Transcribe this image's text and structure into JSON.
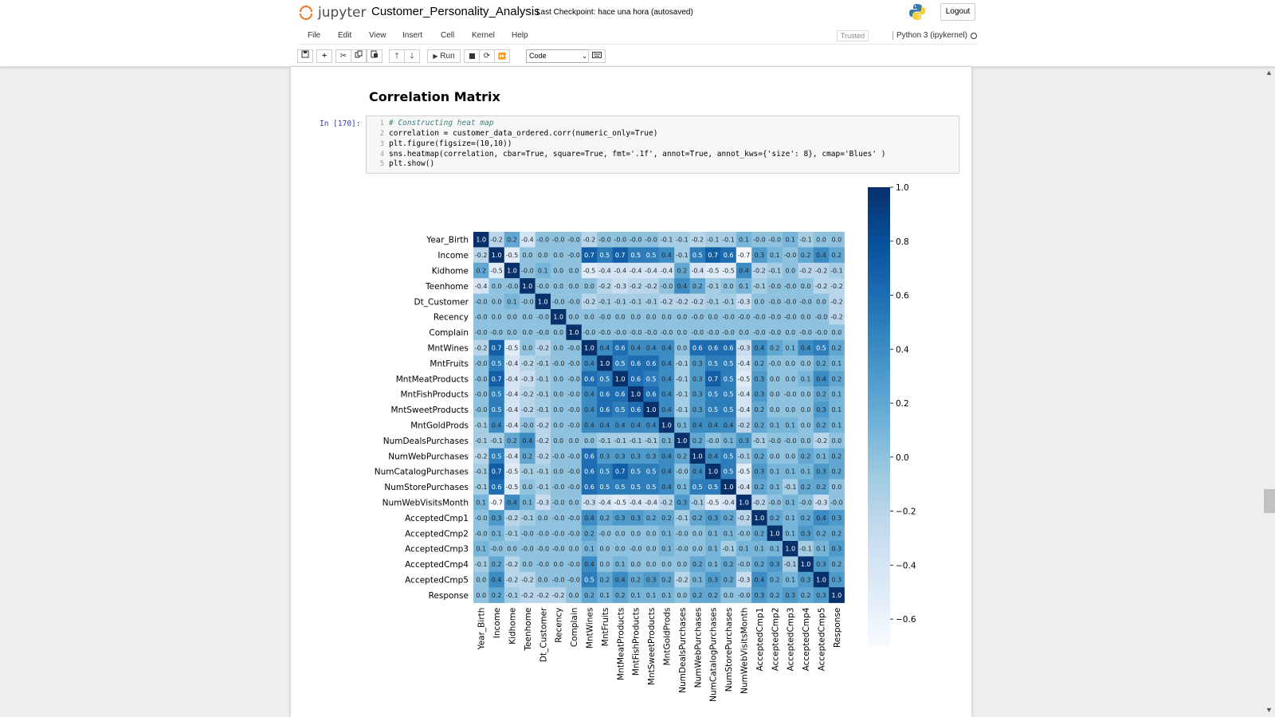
{
  "header": {
    "logo_text": "jupyter",
    "notebook_name": "Customer_Personality_Analysis",
    "checkpoint": "Last Checkpoint: hace una hora",
    "autosaved": "(autosaved)",
    "logout_label": "Logout"
  },
  "menu": {
    "items": [
      "File",
      "Edit",
      "View",
      "Insert",
      "Cell",
      "Kernel",
      "Help"
    ],
    "trusted": "Trusted",
    "kernel_name": "Python 3 (ipykernel)"
  },
  "toolbar": {
    "run_label": "Run",
    "cell_type": "Code",
    "icons": [
      "save-icon",
      "plus-icon",
      "cut-icon",
      "copy-icon",
      "paste-icon",
      "arrow-up-icon",
      "arrow-down-icon",
      "play-icon",
      "stop-icon",
      "restart-icon",
      "fast-forward-icon",
      "keyboard-icon"
    ]
  },
  "notebook": {
    "heading": "Correlation Matrix",
    "prompt": "In [170]:",
    "code_lines": [
      "# Constructing heat map",
      "correlation = customer_data_ordered.corr(numeric_only=True)",
      "plt.figure(figsize=(10,10))",
      "sns.heatmap(correlation, cbar=True, square=True, fmt='.1f', annot=True, annot_kws={'size': 8}, cmap='Blues' )",
      "plt.show()"
    ],
    "line_numbers": [
      "1",
      "2",
      "3",
      "4",
      "5"
    ]
  },
  "chart_data": {
    "type": "heatmap",
    "cmap": "Blues",
    "fmt": ".1f",
    "colorbar": true,
    "colorbar_range": [
      -0.7,
      1.0
    ],
    "colorbar_ticks": [
      1.0,
      0.8,
      0.6,
      0.4,
      0.2,
      0.0,
      -0.2,
      -0.4,
      -0.6
    ],
    "colorbar_tick_labels": [
      "1.0",
      "0.8",
      "0.6",
      "0.4",
      "0.2",
      "0.0",
      "−0.2",
      "−0.4",
      "−0.6"
    ],
    "labels": [
      "Year_Birth",
      "Income",
      "Kidhome",
      "Teenhome",
      "Dt_Customer",
      "Recency",
      "Complain",
      "MntWines",
      "MntFruits",
      "MntMeatProducts",
      "MntFishProducts",
      "MntSweetProducts",
      "MntGoldProds",
      "NumDealsPurchases",
      "NumWebPurchases",
      "NumCatalogPurchases",
      "NumStorePurchases",
      "NumWebVisitsMonth",
      "AcceptedCmp1",
      "AcceptedCmp2",
      "AcceptedCmp3",
      "AcceptedCmp4",
      "AcceptedCmp5",
      "Response"
    ],
    "matrix": [
      [
        1.0,
        -0.2,
        0.2,
        -0.4,
        -0.0,
        -0.0,
        -0.0,
        -0.2,
        -0.0,
        -0.0,
        -0.0,
        -0.0,
        -0.1,
        -0.1,
        -0.2,
        -0.1,
        -0.1,
        0.1,
        -0.0,
        -0.0,
        0.1,
        -0.1,
        0.0,
        0.0
      ],
      [
        -0.2,
        1.0,
        -0.5,
        0.0,
        0.0,
        0.0,
        -0.0,
        0.7,
        0.5,
        0.7,
        0.5,
        0.5,
        0.4,
        -0.1,
        0.5,
        0.7,
        0.6,
        -0.7,
        0.3,
        0.1,
        -0.0,
        0.2,
        0.4,
        0.2
      ],
      [
        0.2,
        -0.5,
        1.0,
        -0.0,
        0.1,
        0.0,
        0.0,
        -0.5,
        -0.4,
        -0.4,
        -0.4,
        -0.4,
        -0.4,
        0.2,
        -0.4,
        -0.5,
        -0.5,
        0.4,
        -0.2,
        -0.1,
        0.0,
        -0.2,
        -0.2,
        -0.1
      ],
      [
        -0.4,
        0.0,
        -0.0,
        1.0,
        -0.0,
        0.0,
        0.0,
        0.0,
        -0.2,
        -0.3,
        -0.2,
        -0.2,
        -0.0,
        0.4,
        0.2,
        -0.1,
        0.0,
        0.1,
        -0.1,
        -0.0,
        -0.0,
        0.0,
        -0.2,
        -0.2
      ],
      [
        -0.0,
        0.0,
        0.1,
        -0.0,
        1.0,
        -0.0,
        -0.0,
        -0.2,
        -0.1,
        -0.1,
        -0.1,
        -0.1,
        -0.2,
        -0.2,
        -0.2,
        -0.1,
        -0.1,
        -0.3,
        0.0,
        -0.0,
        -0.0,
        -0.0,
        0.0,
        -0.2
      ],
      [
        -0.0,
        0.0,
        0.0,
        0.0,
        -0.0,
        1.0,
        0.0,
        0.0,
        -0.0,
        0.0,
        0.0,
        0.0,
        0.0,
        0.0,
        -0.0,
        0.0,
        -0.0,
        -0.0,
        -0.0,
        -0.0,
        -0.0,
        0.0,
        -0.0,
        -0.2
      ],
      [
        -0.0,
        -0.0,
        0.0,
        0.0,
        -0.0,
        0.0,
        1.0,
        -0.0,
        -0.0,
        -0.0,
        -0.0,
        -0.0,
        -0.0,
        0.0,
        -0.0,
        -0.0,
        -0.0,
        0.0,
        -0.0,
        -0.0,
        0.0,
        -0.0,
        -0.0,
        0.0
      ],
      [
        -0.2,
        0.7,
        -0.5,
        0.0,
        -0.2,
        0.0,
        -0.0,
        1.0,
        0.4,
        0.6,
        0.4,
        0.4,
        0.4,
        0.0,
        0.6,
        0.6,
        0.6,
        -0.3,
        0.4,
        0.2,
        0.1,
        0.4,
        0.5,
        0.2
      ],
      [
        -0.0,
        0.5,
        -0.4,
        -0.2,
        -0.1,
        -0.0,
        -0.0,
        0.4,
        1.0,
        0.5,
        0.6,
        0.6,
        0.4,
        -0.1,
        0.3,
        0.5,
        0.5,
        -0.4,
        0.2,
        -0.0,
        0.0,
        0.0,
        0.2,
        0.1
      ],
      [
        -0.0,
        0.7,
        -0.4,
        -0.3,
        -0.1,
        0.0,
        -0.0,
        0.6,
        0.5,
        1.0,
        0.6,
        0.5,
        0.4,
        -0.1,
        0.3,
        0.7,
        0.5,
        -0.5,
        0.3,
        0.0,
        0.0,
        0.1,
        0.4,
        0.2
      ],
      [
        -0.0,
        0.5,
        -0.4,
        -0.2,
        -0.1,
        0.0,
        -0.0,
        0.4,
        0.6,
        0.6,
        1.0,
        0.6,
        0.4,
        -0.1,
        0.3,
        0.5,
        0.5,
        -0.4,
        0.3,
        0.0,
        -0.0,
        0.0,
        0.2,
        0.1
      ],
      [
        -0.0,
        0.5,
        -0.4,
        -0.2,
        -0.1,
        0.0,
        -0.0,
        0.4,
        0.6,
        0.5,
        0.6,
        1.0,
        0.4,
        -0.1,
        0.3,
        0.5,
        0.5,
        -0.4,
        0.2,
        0.0,
        0.0,
        0.0,
        0.3,
        0.1
      ],
      [
        -0.1,
        0.4,
        -0.4,
        -0.0,
        -0.2,
        0.0,
        -0.0,
        0.4,
        0.4,
        0.4,
        0.4,
        0.4,
        1.0,
        0.1,
        0.4,
        0.4,
        0.4,
        -0.2,
        0.2,
        0.1,
        0.1,
        0.0,
        0.2,
        0.1
      ],
      [
        -0.1,
        -0.1,
        0.2,
        0.4,
        -0.2,
        0.0,
        0.0,
        0.0,
        -0.1,
        -0.1,
        -0.1,
        -0.1,
        0.1,
        1.0,
        0.2,
        -0.0,
        0.1,
        0.3,
        -0.1,
        -0.0,
        -0.0,
        0.0,
        -0.2,
        0.0
      ],
      [
        -0.2,
        0.5,
        -0.4,
        0.2,
        -0.2,
        -0.0,
        -0.0,
        0.6,
        0.3,
        0.3,
        0.3,
        0.3,
        0.4,
        0.2,
        1.0,
        0.4,
        0.5,
        -0.1,
        0.2,
        0.0,
        0.0,
        0.2,
        0.1,
        0.2
      ],
      [
        -0.1,
        0.7,
        -0.5,
        -0.1,
        -0.1,
        0.0,
        -0.0,
        0.6,
        0.5,
        0.7,
        0.5,
        0.5,
        0.4,
        -0.0,
        0.4,
        1.0,
        0.5,
        -0.5,
        0.3,
        0.1,
        0.1,
        0.1,
        0.3,
        0.2
      ],
      [
        -0.1,
        0.6,
        -0.5,
        0.0,
        -0.1,
        -0.0,
        -0.0,
        0.6,
        0.5,
        0.5,
        0.5,
        0.5,
        0.4,
        0.1,
        0.5,
        0.5,
        1.0,
        -0.4,
        0.2,
        0.1,
        -0.1,
        0.2,
        0.2,
        0.0
      ],
      [
        0.1,
        -0.7,
        0.4,
        0.1,
        -0.3,
        -0.0,
        0.0,
        -0.3,
        -0.4,
        -0.5,
        -0.4,
        -0.4,
        -0.2,
        0.3,
        -0.1,
        -0.5,
        -0.4,
        1.0,
        -0.2,
        -0.0,
        0.1,
        -0.0,
        -0.3,
        -0.0
      ],
      [
        -0.0,
        0.3,
        -0.2,
        -0.1,
        0.0,
        -0.0,
        -0.0,
        0.4,
        0.2,
        0.3,
        0.3,
        0.2,
        0.2,
        -0.1,
        0.2,
        0.3,
        0.2,
        -0.2,
        1.0,
        0.2,
        0.1,
        0.2,
        0.4,
        0.3
      ],
      [
        -0.0,
        0.1,
        -0.1,
        -0.0,
        -0.0,
        -0.0,
        -0.0,
        0.2,
        -0.0,
        0.0,
        0.0,
        0.0,
        0.1,
        -0.0,
        0.0,
        0.1,
        0.1,
        -0.0,
        0.2,
        1.0,
        0.1,
        0.3,
        0.2,
        0.2
      ],
      [
        0.1,
        -0.0,
        0.0,
        -0.0,
        -0.0,
        -0.0,
        0.0,
        0.1,
        0.0,
        0.0,
        -0.0,
        0.0,
        0.1,
        -0.0,
        0.0,
        0.1,
        -0.1,
        0.1,
        0.1,
        0.1,
        1.0,
        -0.1,
        0.1,
        0.3
      ],
      [
        -0.1,
        0.2,
        -0.2,
        0.0,
        -0.0,
        0.0,
        -0.0,
        0.4,
        0.0,
        0.1,
        0.0,
        0.0,
        0.0,
        0.0,
        0.2,
        0.1,
        0.2,
        -0.0,
        0.2,
        0.3,
        -0.1,
        1.0,
        0.3,
        0.2
      ],
      [
        0.0,
        0.4,
        -0.2,
        -0.2,
        0.0,
        -0.0,
        -0.0,
        0.5,
        0.2,
        0.4,
        0.2,
        0.3,
        0.2,
        -0.2,
        0.1,
        0.3,
        0.2,
        -0.3,
        0.4,
        0.2,
        0.1,
        0.3,
        1.0,
        0.3
      ],
      [
        0.0,
        0.2,
        -0.1,
        -0.2,
        -0.2,
        -0.2,
        0.0,
        0.2,
        0.1,
        0.2,
        0.1,
        0.1,
        0.1,
        0.0,
        0.2,
        0.2,
        0.0,
        -0.0,
        0.3,
        0.2,
        0.3,
        0.2,
        0.3,
        1.0
      ]
    ]
  }
}
